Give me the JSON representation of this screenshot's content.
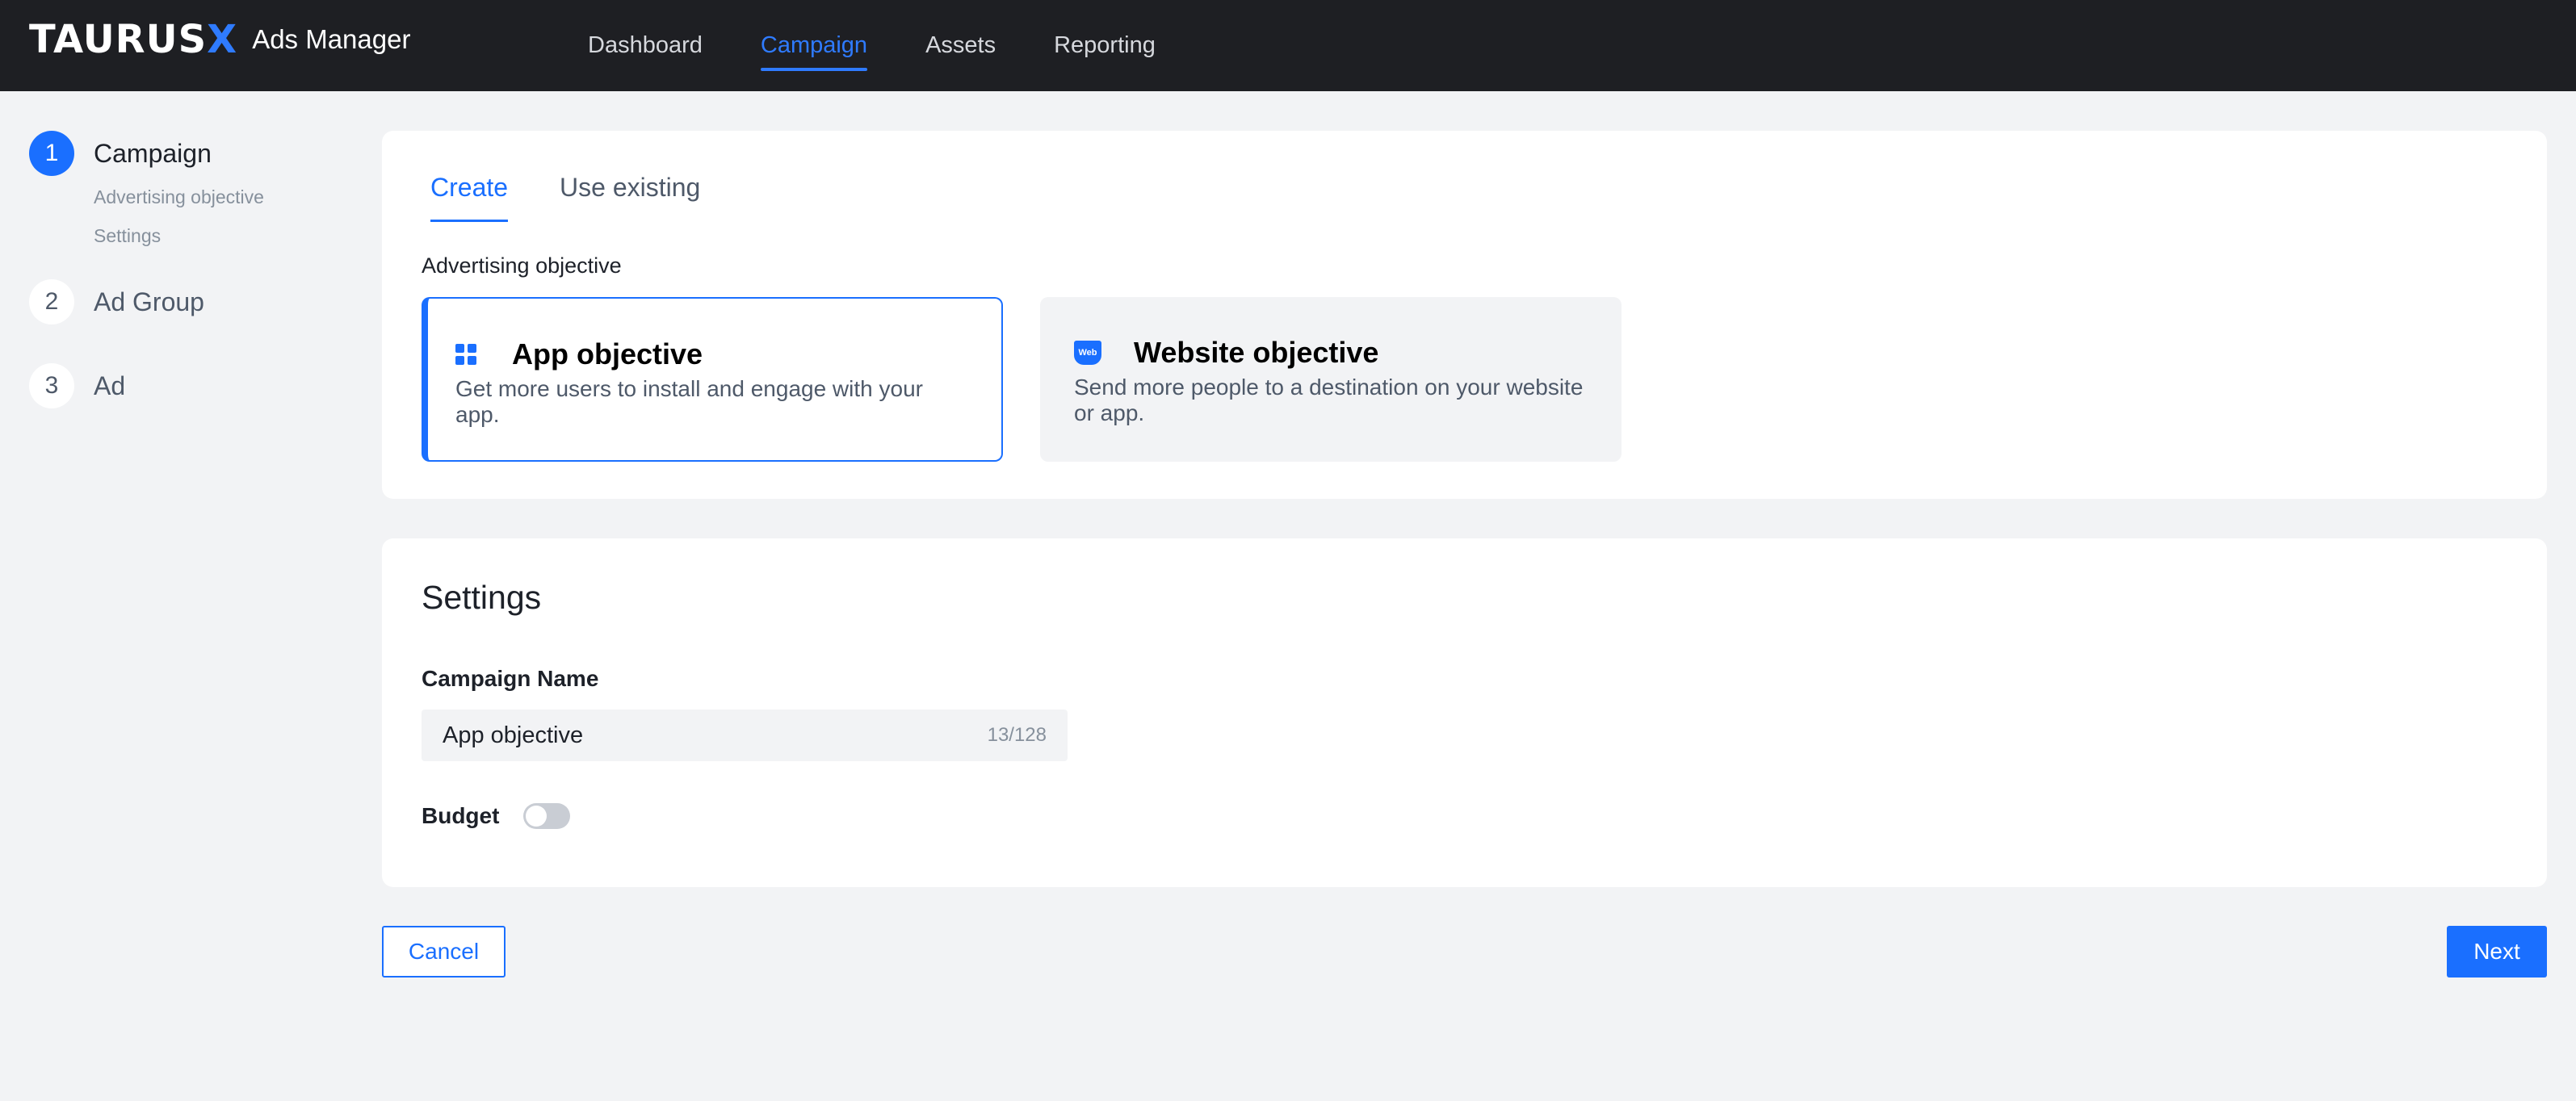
{
  "app": {
    "logo": "TAURUSX",
    "subtitle": "Ads Manager"
  },
  "nav": {
    "items": [
      {
        "label": "Dashboard"
      },
      {
        "label": "Campaign",
        "active": true
      },
      {
        "label": "Assets"
      },
      {
        "label": "Reporting"
      }
    ]
  },
  "steps": [
    {
      "number": "1",
      "title": "Campaign",
      "active": true,
      "substeps": [
        "Advertising objective",
        "Settings"
      ]
    },
    {
      "number": "2",
      "title": "Ad Group"
    },
    {
      "number": "3",
      "title": "Ad"
    }
  ],
  "tabs": [
    {
      "label": "Create",
      "active": true
    },
    {
      "label": "Use existing"
    }
  ],
  "objective": {
    "section_label": "Advertising objective",
    "options": [
      {
        "title": "App objective",
        "description": "Get more users to install and engage with your app.",
        "icon": "grid-icon",
        "selected": true
      },
      {
        "title": "Website objective",
        "description": "Send more people to a destination on your website or app.",
        "icon": "web-icon",
        "icon_text": "Web"
      }
    ]
  },
  "settings": {
    "title": "Settings",
    "campaign_name_label": "Campaign Name",
    "campaign_name_value": "App objective",
    "campaign_name_counter": "13/128",
    "budget_label": "Budget",
    "budget_enabled": false
  },
  "footer": {
    "cancel_label": "Cancel",
    "next_label": "Next"
  },
  "colors": {
    "accent": "#1a6fff",
    "topbar": "#1e1f23",
    "background": "#f2f3f5"
  }
}
